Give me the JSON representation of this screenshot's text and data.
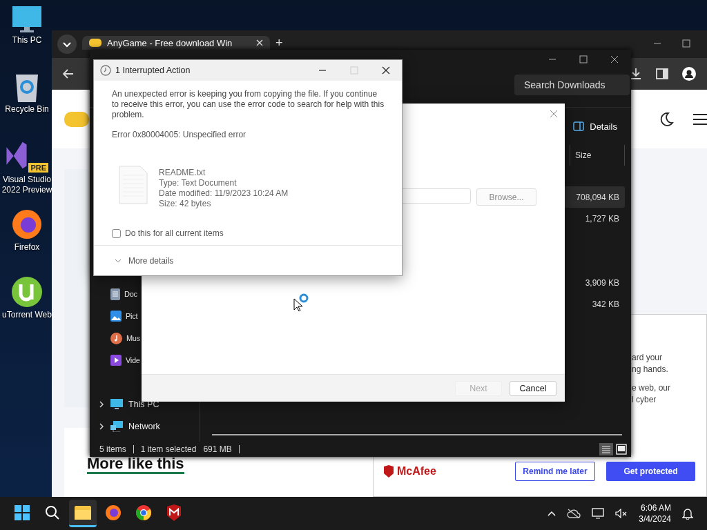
{
  "desktop_icons": [
    {
      "label": "This PC",
      "kind": "pc"
    },
    {
      "label": "Recycle Bin",
      "kind": "bin"
    },
    {
      "label": "Visual Studio 2022 Preview",
      "kind": "vs",
      "badge": "PRE"
    },
    {
      "label": "Firefox",
      "kind": "firefox"
    },
    {
      "label": "uTorrent Web",
      "kind": "utorrent"
    }
  ],
  "browser": {
    "tabs": [
      {
        "title": "AnyGame - Free download Win",
        "selected": true
      }
    ],
    "new_tab": "+",
    "page": {
      "heading": "More like this",
      "popup": {
        "text_lines": [
          "ard your",
          "ng hands.",
          "e web, our",
          "l cyber"
        ],
        "brand": "McAfee",
        "buttons": [
          {
            "label": "Remind me later",
            "kind": "outline"
          },
          {
            "label": "Get protected",
            "kind": "primary"
          }
        ]
      }
    }
  },
  "explorer": {
    "search": {
      "placeholder": "Search Downloads"
    },
    "details_button": "Details",
    "columns": [
      "Size"
    ],
    "rows": [
      {
        "size": "708,094 KB",
        "selected": true
      },
      {
        "size": "1,727 KB",
        "selected": false
      },
      {
        "selected": false
      },
      {
        "selected": false
      },
      {
        "size": "3,909 KB",
        "selected": false
      },
      {
        "size": "342 KB",
        "selected": false
      }
    ],
    "sidebar": [
      {
        "label": "Doc",
        "kind": "documents"
      },
      {
        "label": "Pict",
        "kind": "pictures"
      },
      {
        "label": "Mus",
        "kind": "music"
      },
      {
        "label": "Vide",
        "kind": "videos"
      }
    ],
    "sidebar_roots": [
      {
        "label": "This PC",
        "kind": "pc",
        "expanded": false
      },
      {
        "label": "Network",
        "kind": "network",
        "expanded": false
      }
    ],
    "status_bar": {
      "items": "5 items",
      "selection": "1 item selected",
      "size": "691 MB"
    }
  },
  "copy_dialog": {
    "browse_button": "Browse...",
    "buttons": [
      {
        "label": "Next",
        "disabled": true
      },
      {
        "label": "Cancel",
        "disabled": false
      }
    ]
  },
  "error_dialog": {
    "title": "1 Interrupted Action",
    "message": "An unexpected error is keeping you from copying the file. If you continue to receive this error, you can use the error code to search for help with this problem.",
    "error": "Error 0x80004005: Unspecified error",
    "file": {
      "name": "README.txt",
      "type": "Type: Text Document",
      "modified": "Date modified: 11/9/2023 10:24 AM",
      "size": "Size: 42 bytes"
    },
    "checkbox": {
      "label": "Do this for all current items",
      "checked": false
    },
    "more_details": "More details"
  },
  "taskbar": {
    "apps": [
      {
        "kind": "start",
        "active": false
      },
      {
        "kind": "search",
        "active": false
      },
      {
        "kind": "explorer",
        "active": true
      },
      {
        "kind": "firefox",
        "active": false
      },
      {
        "kind": "chrome",
        "active": false
      },
      {
        "kind": "mcafee",
        "active": false
      }
    ],
    "time": "6:06 AM",
    "date": "3/4/2024"
  }
}
